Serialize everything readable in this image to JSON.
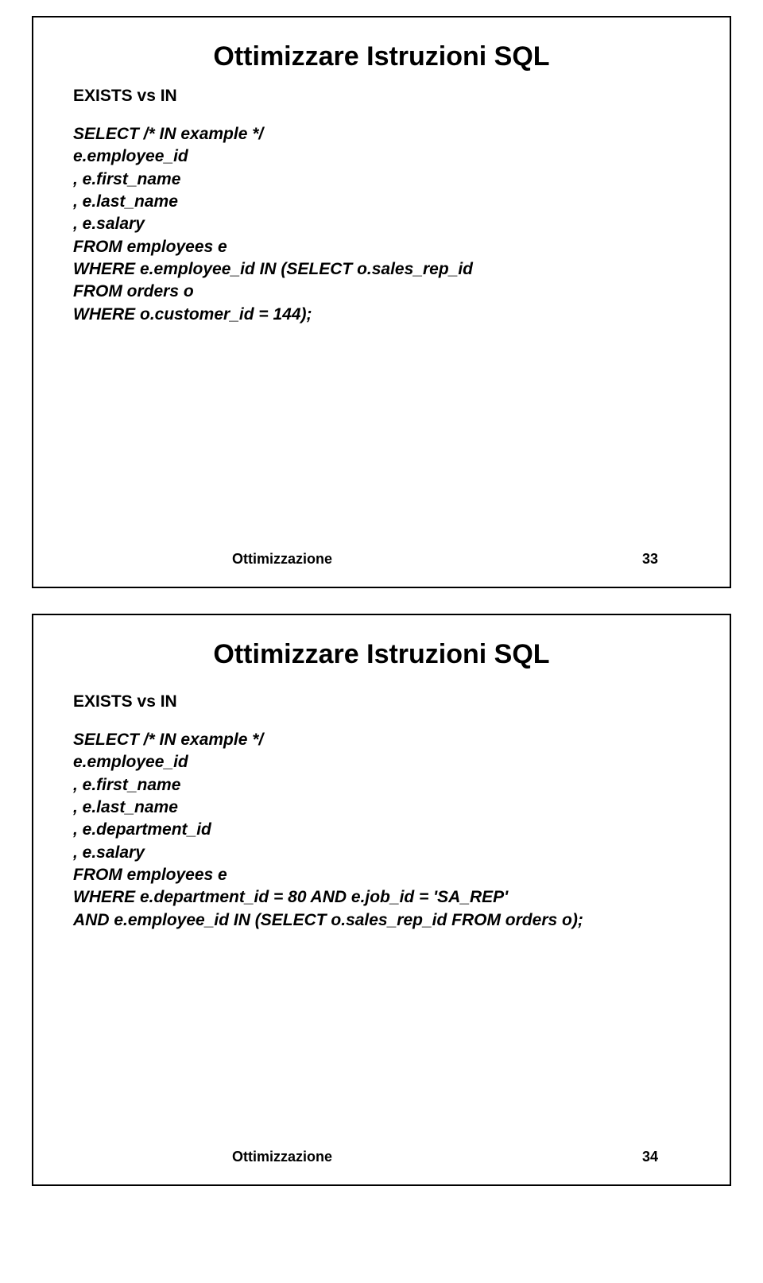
{
  "slide1": {
    "title": "Ottimizzare Istruzioni SQL",
    "section": "EXISTS vs IN",
    "code": "SELECT /* IN example */\ne.employee_id\n, e.first_name\n, e.last_name\n, e.salary\nFROM employees e\nWHERE e.employee_id IN (SELECT o.sales_rep_id\nFROM orders o\nWHERE o.customer_id = 144);",
    "footer_label": "Ottimizzazione",
    "footer_num": "33"
  },
  "slide2": {
    "title": "Ottimizzare Istruzioni SQL",
    "section": "EXISTS vs IN",
    "code": "SELECT /* IN example */\ne.employee_id\n, e.first_name\n, e.last_name\n, e.department_id\n, e.salary\nFROM employees e\nWHERE e.department_id = 80 AND e.job_id = 'SA_REP'\nAND e.employee_id IN (SELECT o.sales_rep_id FROM orders o);",
    "footer_label": "Ottimizzazione",
    "footer_num": "34"
  }
}
